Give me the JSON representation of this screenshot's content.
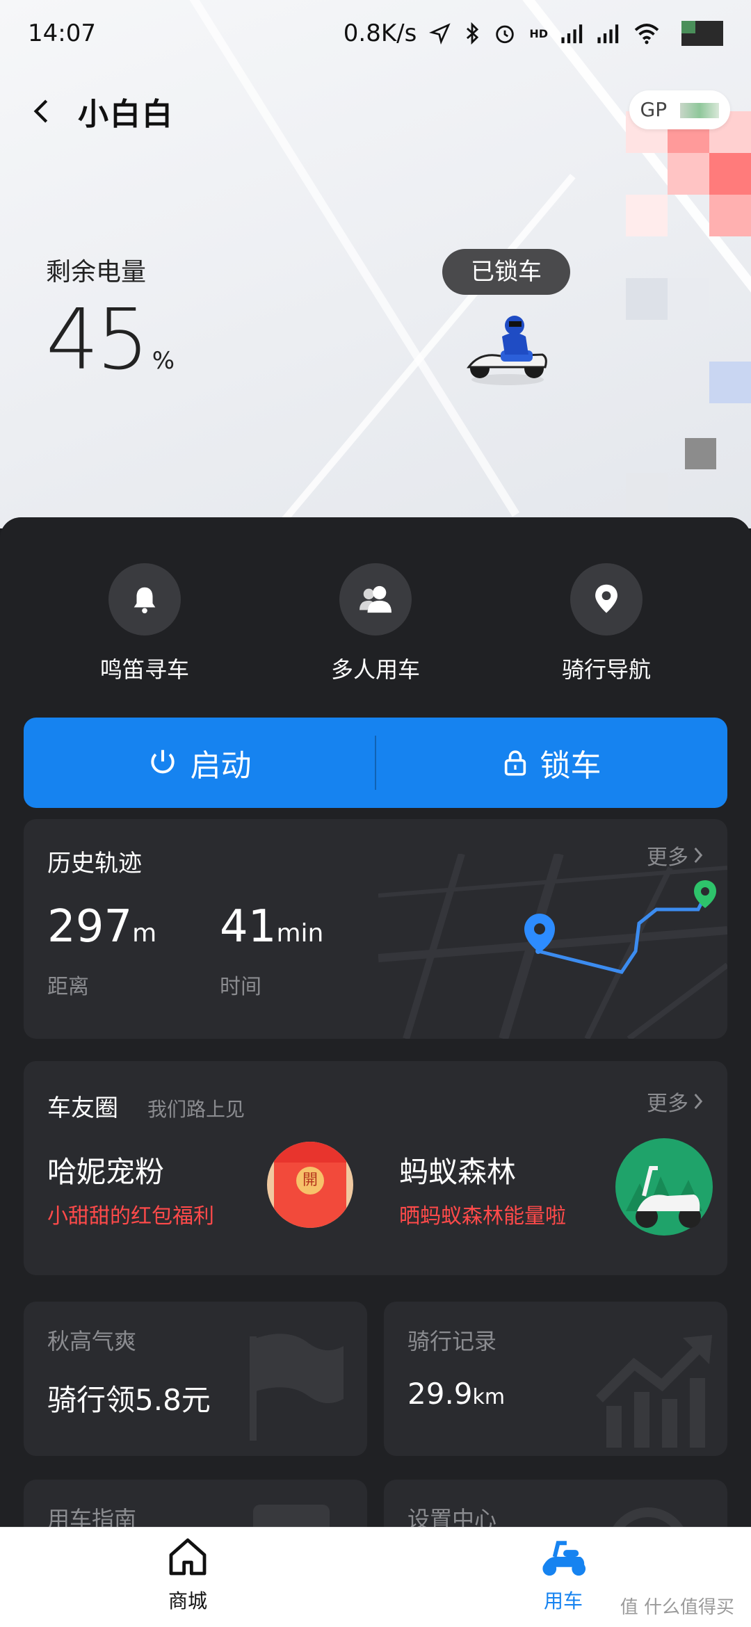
{
  "status_bar": {
    "time": "14:07",
    "net_speed": "0.8K/s",
    "network": "HD"
  },
  "header": {
    "title": "小白白",
    "gps_label": "GP"
  },
  "battery": {
    "label": "剩余电量",
    "value": "45",
    "unit": "%"
  },
  "lock_status": "已锁车",
  "quick_actions": [
    {
      "label": "鸣笛寻车",
      "icon": "bell-icon"
    },
    {
      "label": "多人用车",
      "icon": "users-icon"
    },
    {
      "label": "骑行导航",
      "icon": "location-pin-icon"
    }
  ],
  "actions": {
    "start_label": "启动",
    "lock_label": "锁车",
    "color": "#1683f0"
  },
  "history": {
    "title": "历史轨迹",
    "more": "更多",
    "distance_value": "297",
    "distance_unit": "m",
    "distance_label": "距离",
    "time_value": "41",
    "time_unit": "min",
    "time_label": "时间"
  },
  "community": {
    "title": "车友圈",
    "subtitle": "我们路上见",
    "more": "更多",
    "items": [
      {
        "title": "哈妮宠粉",
        "subtitle": "小甜甜的红包福利",
        "badge": "開"
      },
      {
        "title": "蚂蚁森林",
        "subtitle": "晒蚂蚁森林能量啦"
      }
    ]
  },
  "mini_cards": [
    {
      "title": "秋高气爽",
      "value": "骑行领5.8元"
    },
    {
      "title": "骑行记录",
      "value": "29.9",
      "unit": "km"
    },
    {
      "title": "用车指南"
    },
    {
      "title": "设置中心"
    }
  ],
  "tabs": [
    {
      "label": "商城",
      "active": false
    },
    {
      "label": "用车",
      "active": true
    }
  ],
  "watermark": "值 什么值得买",
  "colors": {
    "accent": "#1683f0",
    "promo_red": "#ff4a4a",
    "panel": "#202124"
  }
}
